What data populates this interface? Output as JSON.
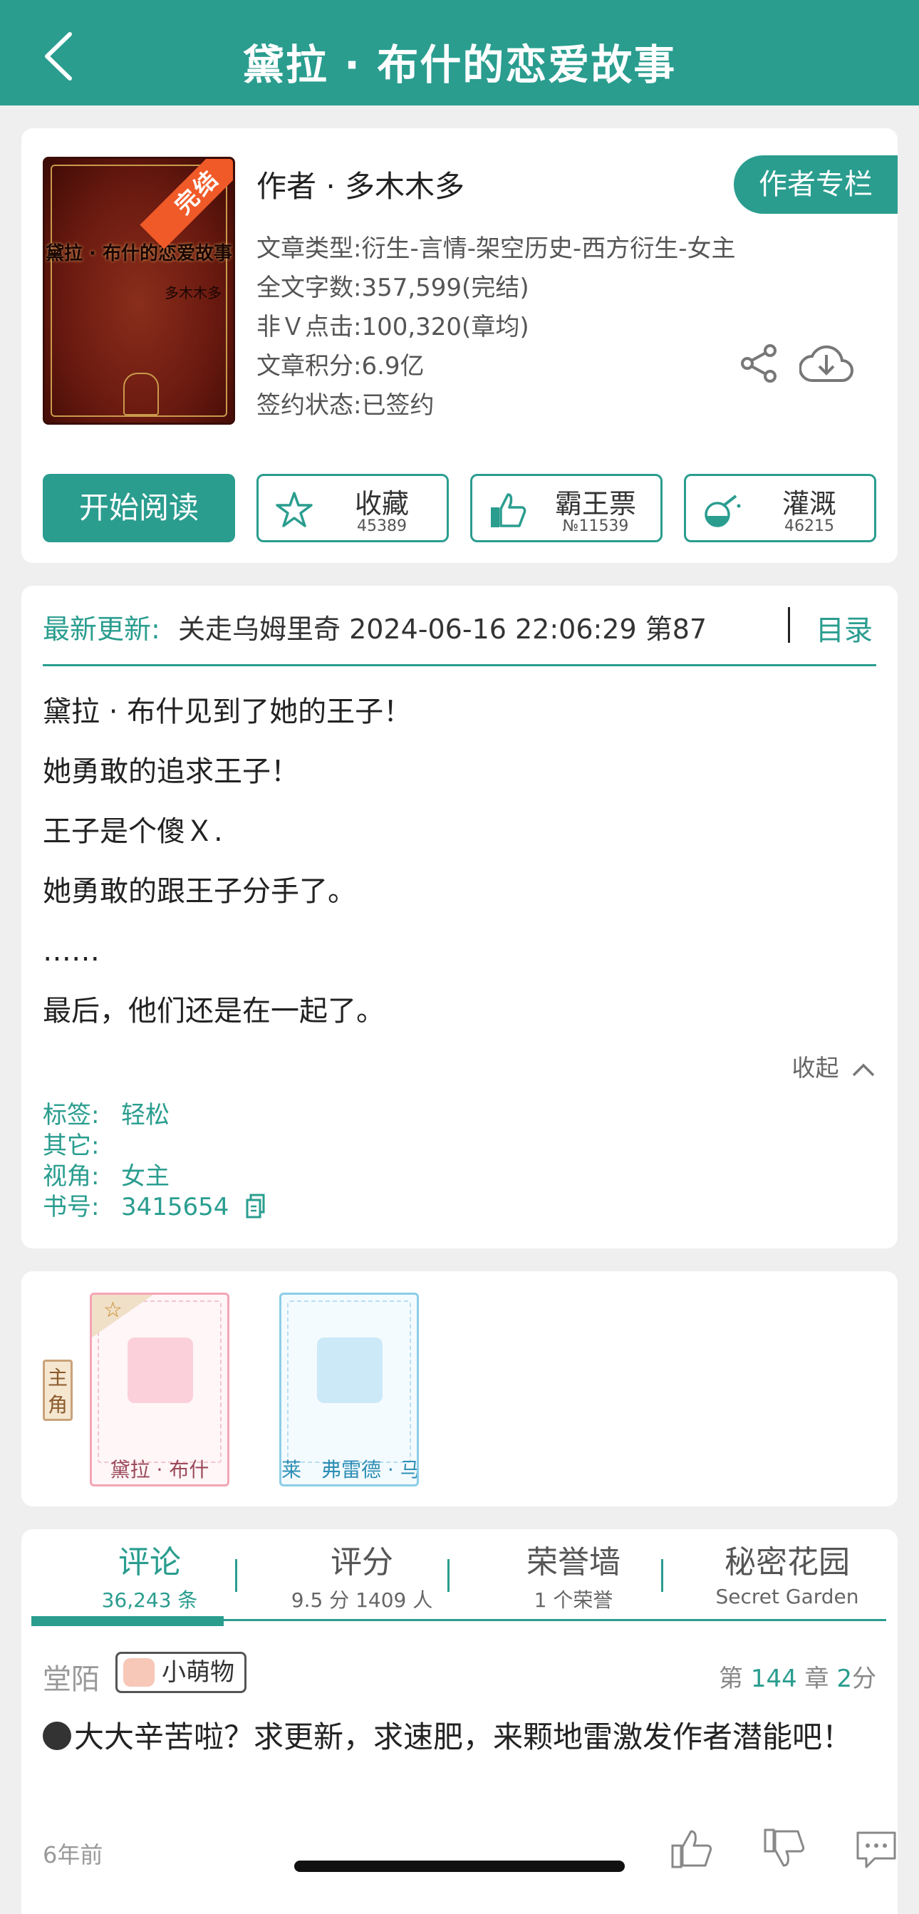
{
  "header": {
    "title": "黛拉 · 布什的恋爱故事",
    "back_icon": "chevron-left-icon"
  },
  "book": {
    "cover": {
      "status_ribbon": "完结",
      "title": "黛拉 · 布什的恋爱故事",
      "author": "多木木多"
    },
    "author_line": "作者 · 多木木多",
    "author_column_button": "作者专栏",
    "meta": [
      "文章类型:衍生-言情-架空历史-西方衍生-女主",
      "全文字数:357,599(完结)",
      "非Ｖ点击:100,320(章均)",
      "文章积分:6.9亿",
      "签约状态:已签约"
    ],
    "start_reading": "开始阅读",
    "actions": [
      {
        "label": "收藏",
        "count": "45389",
        "icon": "star-icon"
      },
      {
        "label": "霸王票",
        "count": "№11539",
        "icon": "thumbs-up-icon"
      },
      {
        "label": "灌溉",
        "count": "46215",
        "icon": "watering-icon"
      }
    ]
  },
  "update": {
    "label": "最新更新:",
    "text": "关走乌姆里奇 2024-06-16 22:06:29  第87",
    "toc": "目录"
  },
  "intro": {
    "lines": [
      "黛拉 · 布什见到了她的王子！",
      "她勇敢的追求王子！",
      "王子是个傻Ｘ.",
      "她勇敢的跟王子分手了。",
      "……",
      "最后，他们还是在一起了。"
    ],
    "collapse": "收起"
  },
  "tags": {
    "tag_key": "标签:",
    "tag_val": "轻松",
    "other_key": "其它:",
    "other_val": "",
    "view_key": "视角:",
    "view_val": "女主",
    "id_key": "书号:",
    "id_val": "3415654"
  },
  "characters": {
    "role_label": "主角",
    "items": [
      {
        "name": "黛拉 · 布什"
      },
      {
        "name": "莱　弗雷德 · 马"
      }
    ]
  },
  "tabs": [
    {
      "title": "评论",
      "sub": "36,243 条"
    },
    {
      "title": "评分",
      "sub": "9.5 分 1409 人"
    },
    {
      "title": "荣誉墙",
      "sub": "1 个荣誉"
    },
    {
      "title": "秘密花园",
      "sub": "Secret Garden"
    }
  ],
  "comment": {
    "user": "堂陌",
    "badge": "小萌物",
    "chapter_prefix": "第",
    "chapter_num": "144",
    "chapter_mid": "章",
    "score_num": "2",
    "score_suffix": "分",
    "text": "大大辛苦啦？求更新，求速肥，来颗地雷激发作者潜能吧！",
    "time": "6年前"
  },
  "colors": {
    "accent": "#2a9d8f",
    "cover_ribbon": "#f05a28"
  }
}
